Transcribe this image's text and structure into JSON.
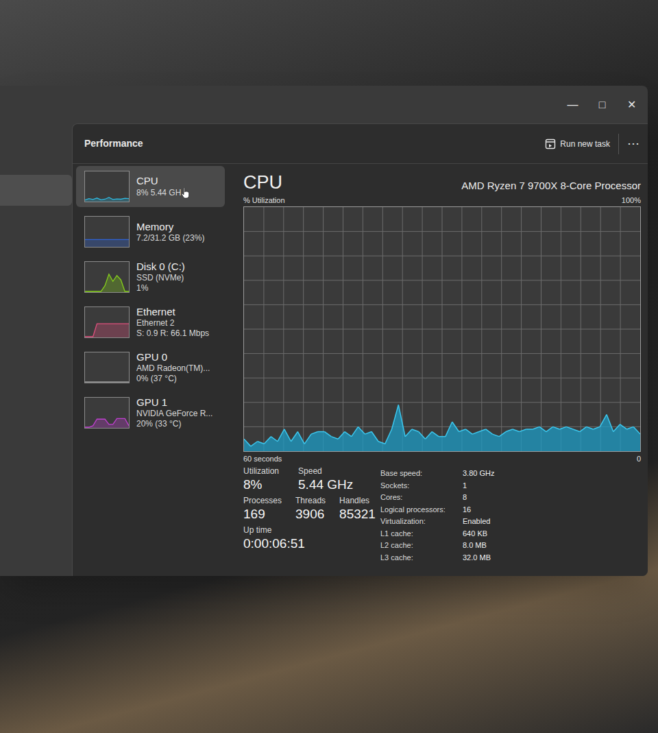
{
  "window": {
    "controls": [
      "—",
      "□",
      "✕"
    ]
  },
  "nav_items": [
    {
      "selected": true
    }
  ],
  "header": {
    "title": "Performance",
    "run_task": "Run new task",
    "more": "⋯"
  },
  "sidebar": {
    "items": [
      {
        "label": "CPU",
        "lines": [
          "8% 5.44 GH"
        ],
        "selected": true,
        "color": "#2fb6dc",
        "values": [
          3,
          8,
          5,
          10,
          4,
          6,
          12,
          5,
          7,
          6,
          9,
          8
        ]
      },
      {
        "label": "Memory",
        "lines": [
          "7.2/31.2 GB (23%)"
        ],
        "selected": false,
        "color": "#2f63d6",
        "values": [
          23,
          23,
          23,
          23,
          23,
          23,
          23,
          23,
          23,
          23,
          23,
          23
        ]
      },
      {
        "label": "Disk 0 (C:)",
        "lines": [
          "SSD (NVMe)",
          "1%"
        ],
        "selected": false,
        "color": "#86cf1c",
        "values": [
          0,
          0,
          0,
          0,
          0,
          20,
          60,
          35,
          55,
          40,
          0,
          0
        ]
      },
      {
        "label": "Ethernet",
        "lines": [
          "Ethernet 2",
          "S: 0.9 R: 66.1 Mbps"
        ],
        "selected": false,
        "color": "#e0507e",
        "values": [
          0,
          0,
          0,
          45,
          45,
          45,
          45,
          45,
          45,
          45,
          45,
          45
        ]
      },
      {
        "label": "GPU 0",
        "lines": [
          "AMD Radeon(TM)...",
          "0% (37 °C)"
        ],
        "selected": false,
        "color": "#9a9a9a",
        "values": [
          0,
          0,
          0,
          0,
          0,
          0,
          0,
          0,
          0,
          0,
          0,
          0
        ]
      },
      {
        "label": "GPU 1",
        "lines": [
          "NVIDIA GeForce R...",
          "20% (33 °C)"
        ],
        "selected": false,
        "color": "#c040d0",
        "values": [
          0,
          0,
          5,
          28,
          28,
          28,
          10,
          10,
          30,
          30,
          30,
          5
        ]
      }
    ]
  },
  "main": {
    "title": "CPU",
    "processor": "AMD Ryzen 7 9700X 8-Core Processor",
    "y_label": "% Utilization",
    "y_max": "100%",
    "x_label": "60 seconds",
    "x_end": "0",
    "series": [
      5,
      2,
      4,
      3,
      6,
      4,
      9,
      4,
      8,
      3,
      7,
      8,
      8,
      6,
      5,
      8,
      6,
      10,
      7,
      8,
      4,
      3,
      9,
      19,
      6,
      9,
      8,
      5,
      8,
      6,
      6,
      12,
      8,
      9,
      7,
      8,
      9,
      7,
      6,
      8,
      9,
      8,
      9,
      9,
      10,
      8,
      10,
      9,
      10,
      9,
      8,
      10,
      9,
      10,
      15,
      8,
      11,
      9,
      10,
      7
    ]
  },
  "stats": [
    [
      {
        "label": "Utilization",
        "value": "8%"
      },
      {
        "label": "Speed",
        "value": "5.44 GHz"
      }
    ],
    [
      {
        "label": "Processes",
        "value": "169"
      },
      {
        "label": "Threads",
        "value": "3906"
      },
      {
        "label": "Handles",
        "value": "85321"
      }
    ],
    [
      {
        "label": "Up time",
        "value": "0:00:06:51"
      }
    ]
  ],
  "specs": [
    {
      "label": "Base speed:",
      "value": "3.80 GHz"
    },
    {
      "label": "Sockets:",
      "value": "1"
    },
    {
      "label": "Cores:",
      "value": "8"
    },
    {
      "label": "Logical processors:",
      "value": "16"
    },
    {
      "label": "Virtualization:",
      "value": "Enabled"
    },
    {
      "label": "L1 cache:",
      "value": "640 KB"
    },
    {
      "label": "L2 cache:",
      "value": "8.0 MB"
    },
    {
      "label": "L3 cache:",
      "value": "32.0 MB"
    }
  ]
}
